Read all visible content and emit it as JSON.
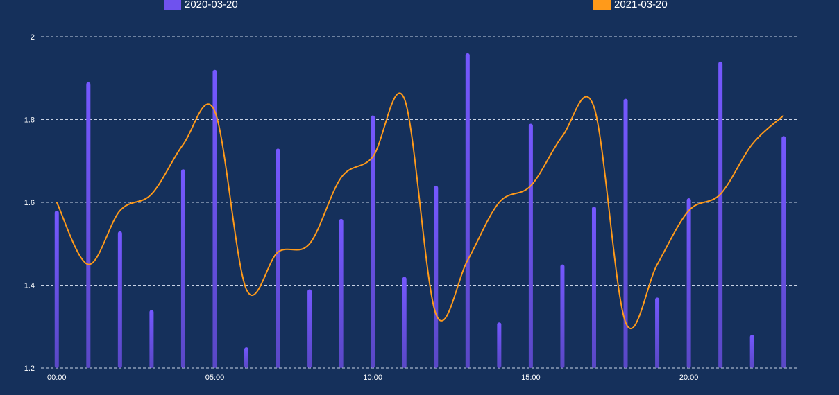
{
  "chart_data": {
    "type": "bar",
    "title": "",
    "xlabel": "",
    "ylabel": "",
    "x": [
      "00:00",
      "01:00",
      "02:00",
      "03:00",
      "04:00",
      "05:00",
      "06:00",
      "07:00",
      "08:00",
      "09:00",
      "10:00",
      "11:00",
      "12:00",
      "13:00",
      "14:00",
      "15:00",
      "16:00",
      "17:00",
      "18:00",
      "19:00",
      "20:00",
      "21:00",
      "22:00",
      "23:00"
    ],
    "x_tick_labels": [
      "00:00",
      "05:00",
      "10:00",
      "15:00",
      "20:00"
    ],
    "y_ticks": [
      "1.2",
      "1.4",
      "1.6",
      "1.8",
      "2"
    ],
    "ylim": [
      1.2,
      2.0
    ],
    "grid": "horizontal dashed",
    "legend_position": "top",
    "series": [
      {
        "name": "2020-03-20",
        "type": "bar",
        "color": "#7b5cf5",
        "values": [
          1.58,
          1.89,
          1.53,
          1.34,
          1.68,
          1.92,
          1.25,
          1.73,
          1.39,
          1.56,
          1.81,
          1.42,
          1.64,
          1.96,
          1.31,
          1.79,
          1.45,
          1.59,
          1.85,
          1.37,
          1.61,
          1.94,
          1.28,
          1.76
        ]
      },
      {
        "name": "2021-03-20",
        "type": "line",
        "color": "#ff9a1a",
        "values": [
          1.6,
          1.45,
          1.58,
          1.62,
          1.74,
          1.82,
          1.39,
          1.48,
          1.5,
          1.66,
          1.71,
          1.85,
          1.33,
          1.46,
          1.6,
          1.64,
          1.76,
          1.83,
          1.31,
          1.45,
          1.58,
          1.62,
          1.74,
          1.81
        ]
      }
    ]
  }
}
